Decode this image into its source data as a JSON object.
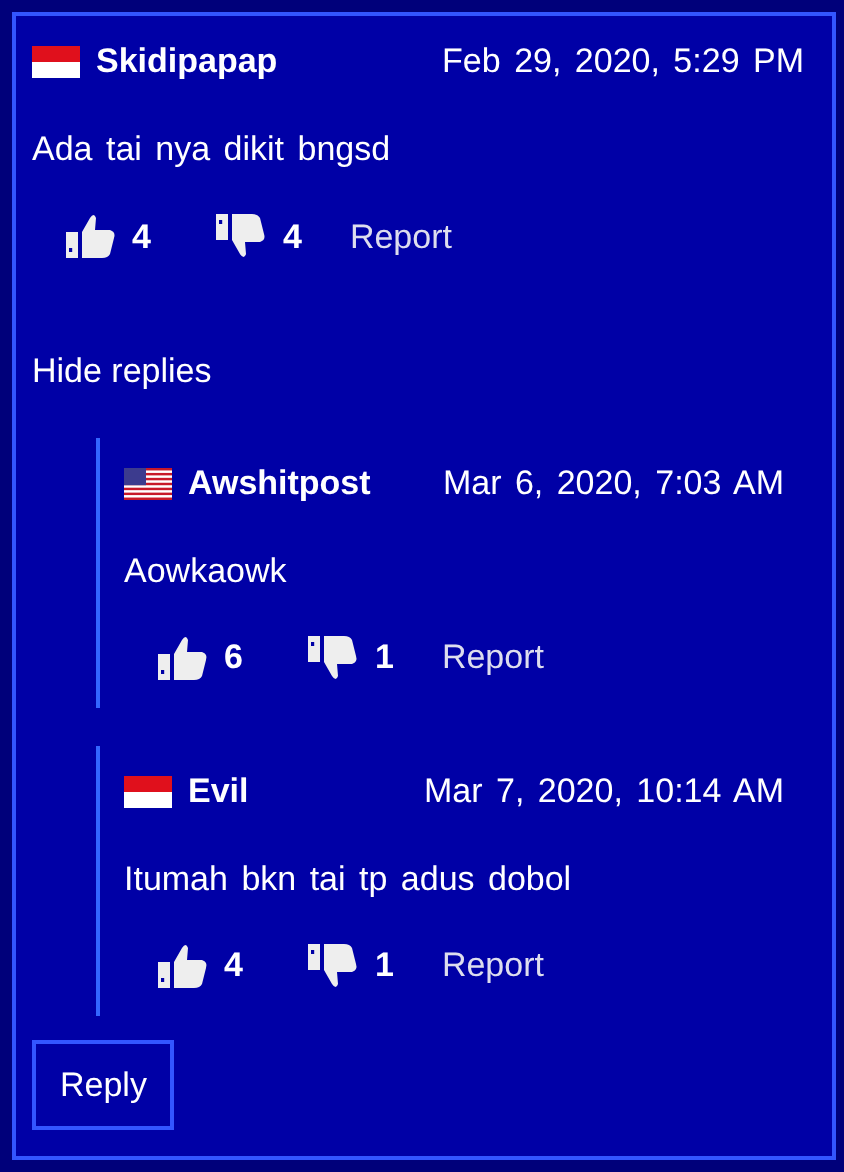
{
  "comment": {
    "kind": "indonesia",
    "author": "Skidipapap",
    "date": "Feb 29, 2020, 5:29 PM",
    "text": "Ada tai nya dikit bngsd",
    "likes": "4",
    "dislikes": "4",
    "report": "Report"
  },
  "toggle_replies": "Hide replies",
  "replies": [
    {
      "kind": "usa",
      "author": "Awshitpost",
      "date": "Mar 6, 2020, 7:03  AM",
      "text": "Aowkaowk",
      "likes": "6",
      "dislikes": "1",
      "report": "Report"
    },
    {
      "kind": "indonesia",
      "author": "Evil",
      "date": "Mar 7, 2020, 10:14  AM",
      "text": "Itumah bkn tai tp adus dobol",
      "likes": "4",
      "dislikes": "1",
      "report": "Report"
    }
  ],
  "reply_button": "Reply"
}
